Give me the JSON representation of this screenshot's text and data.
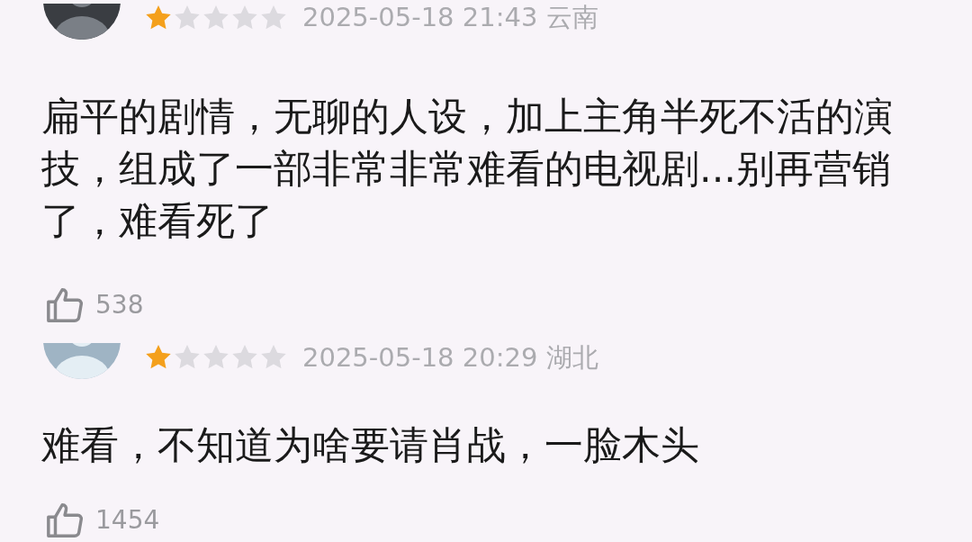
{
  "reviews": [
    {
      "stars": 1,
      "date": "2025-05-18 21:43",
      "region": "云南",
      "text": "扁平的剧情，无聊的人设，加上主角半死不活的演技，组成了一部非常非常难看的电视剧...别再营销了，难看死了",
      "likes": "538"
    },
    {
      "stars": 1,
      "date": "2025-05-18 20:29",
      "region": "湖北",
      "text": "难看，不知道为啥要请肖战，一脸木头",
      "likes": "1454"
    }
  ]
}
